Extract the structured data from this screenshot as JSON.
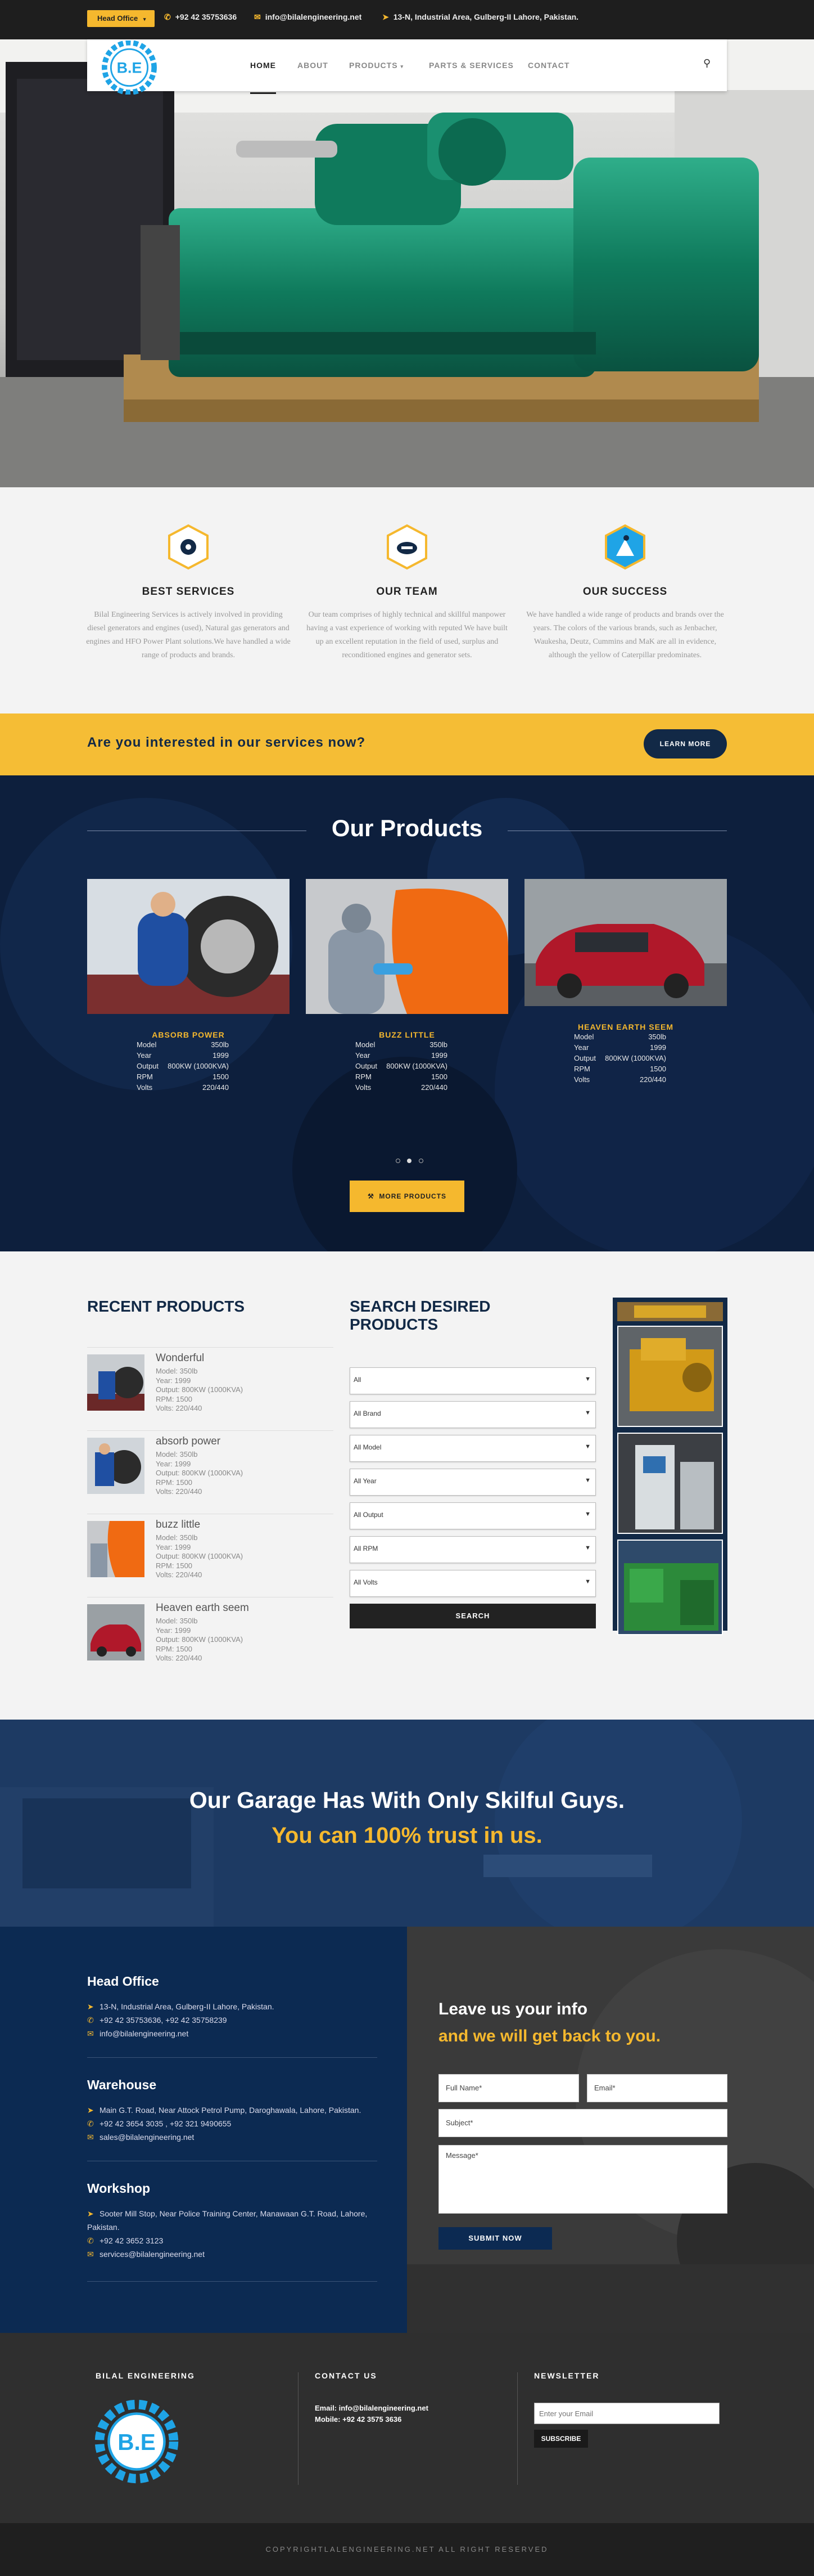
{
  "topbar": {
    "office_label": "Head Office",
    "phone": "+92 42 35753636",
    "email": "info@bilalengineering.net",
    "address": "13-N, Industrial Area, Gulberg-II Lahore, Pakistan."
  },
  "nav": {
    "logo_text": "B.E",
    "items": [
      "HOME",
      "ABOUT",
      "PRODUCTS",
      "PARTS & SERVICES",
      "CONTACT"
    ],
    "active": "HOME"
  },
  "features": [
    {
      "title": "BEST SERVICES",
      "icon": "hand-gear-icon",
      "text": "Bilal Engineering Services is actively involved in providing diesel generators and engines (used), Natural gas generators and engines and HFO Power Plant solutions.We have handled a wide range of products and brands."
    },
    {
      "title": "OUR TEAM",
      "icon": "handshake-icon",
      "text": "Our team comprises of highly technical and skillful manpower having a vast experience of working with reputed We have built up an excellent reputation in the field of used, surplus and reconditioned engines and generator sets."
    },
    {
      "title": "OUR SUCCESS",
      "icon": "climber-icon",
      "text": "We have handled a wide range of products and brands over the years. The colors of the various brands, such as Jenbacher, Waukesha, Deutz, Cummins and MaK are all in evidence, although the yellow of Caterpillar predominates."
    }
  ],
  "cta": {
    "question": "Are you interested in our services now?",
    "button": "LEARN MORE"
  },
  "products": {
    "title": "Our Products",
    "spec_labels": [
      "Model",
      "Year",
      "Output",
      "RPM",
      "Volts"
    ],
    "items": [
      {
        "name": "ABSORB POWER",
        "specs": [
          "350lb",
          "1999",
          "800KW (1000KVA)",
          "1500",
          "220/440"
        ]
      },
      {
        "name": "BUZZ LITTLE",
        "specs": [
          "350lb",
          "1999",
          "800KW (1000KVA)",
          "1500",
          "220/440"
        ]
      },
      {
        "name": "HEAVEN EARTH SEEM",
        "specs": [
          "350lb",
          "1999",
          "800KW (1000KVA)",
          "1500",
          "220/440"
        ]
      }
    ],
    "more_button": "MORE PRODUCTS"
  },
  "recent": {
    "title": "RECENT PRODUCTS",
    "items": [
      {
        "name": "Wonderful",
        "specs": [
          "Model: 350lb",
          "Year: 1999",
          "Output: 800KW (1000KVA)",
          "RPM: 1500",
          "Volts: 220/440"
        ]
      },
      {
        "name": "absorb power",
        "specs": [
          "Model: 350lb",
          "Year: 1999",
          "Output: 800KW (1000KVA)",
          "RPM: 1500",
          "Volts: 220/440"
        ]
      },
      {
        "name": "buzz little",
        "specs": [
          "Model: 350lb",
          "Year: 1999",
          "Output: 800KW (1000KVA)",
          "RPM: 1500",
          "Volts: 220/440"
        ]
      },
      {
        "name": "Heaven earth seem",
        "specs": [
          "Model: 350lb",
          "Year: 1999",
          "Output: 800KW (1000KVA)",
          "RPM: 1500",
          "Volts: 220/440"
        ]
      }
    ]
  },
  "search": {
    "title": "SEARCH DESIRED PRODUCTS",
    "selects": [
      "All",
      "All Brand",
      "All Model",
      "All Year",
      "All Output",
      "All RPM",
      "All Volts"
    ],
    "button": "SEARCH"
  },
  "garage": {
    "line1": "Our Garage Has With Only Skilful Guys.",
    "line2": "You can 100% trust in us."
  },
  "contact": {
    "head_office": {
      "title": "Head Office",
      "address": "13-N, Industrial Area, Gulberg-II Lahore, Pakistan.",
      "phone": "+92 42 35753636, +92 42 35758239",
      "email": "info@bilalengineering.net"
    },
    "warehouse": {
      "title": "Warehouse",
      "address": "Main G.T. Road, Near Attock Petrol Pump, Daroghawala, Lahore, Pakistan.",
      "phone": "+92 42 3654 3035 , +92 321 9490655",
      "email": "sales@bilalengineering.net"
    },
    "workshop": {
      "title": "Workshop",
      "address": "Sooter Mill Stop, Near Police Training Center, Manawaan G.T. Road, Lahore, Pakistan.",
      "phone": "+92 42 3652 3123",
      "email": "services@bilalengineering.net"
    },
    "form": {
      "title1": "Leave us your info",
      "title2": "and we will get back to you.",
      "name": "Full Name*",
      "email": "Email*",
      "subject": "Subject*",
      "message": "Message*",
      "submit": "SUBMIT NOW"
    }
  },
  "footer": {
    "col1_title": "BILAL ENGINEERING",
    "col2_title": "CONTACT US",
    "email": "Email: info@bilalengineering.net",
    "mobile": "Mobile: +92 42 3575 3636",
    "col3_title": "NEWSLETTER",
    "newsletter_placeholder": "Enter your Email",
    "subscribe": "SUBSCRIBE",
    "copyright": "COPYRIGHTLALENGINEERING.NET ALL RIGHT RESERVED"
  }
}
